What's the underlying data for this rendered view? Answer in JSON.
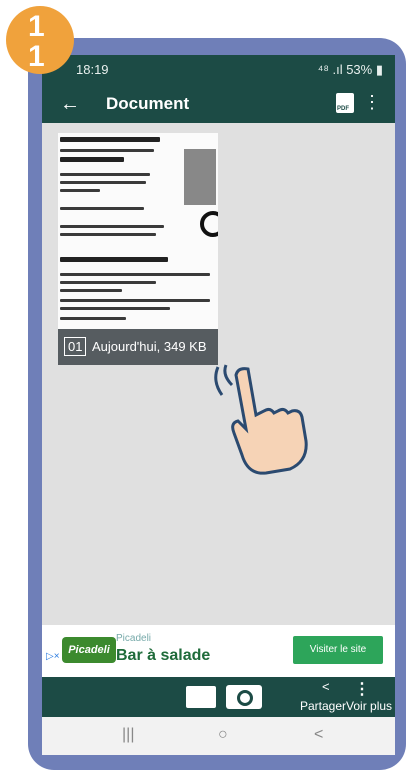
{
  "step": {
    "line1": "1",
    "line2": "1"
  },
  "status_bar": {
    "time": "18:19",
    "right": "⁴⁸ .ıl 53% ▮"
  },
  "app_bar": {
    "back": "←",
    "title": "Document",
    "pdf": "PDF",
    "more": "⋮"
  },
  "document": {
    "index": "01",
    "info": "Aujourd'hui, 349 KB"
  },
  "ad": {
    "logo": "Picadeli",
    "brand": "Picadeli",
    "headline": "Bar à salade",
    "cta": "Visiter le site"
  },
  "bottom_bar": {
    "share": "<",
    "more": "⋮",
    "labels": "PartagerVoir plus"
  },
  "nav": {
    "recent": "|||",
    "home": "○",
    "back": "<"
  },
  "colors": {
    "header": "#1c4b45",
    "accent": "#f0a23c",
    "frame": "#6f7fb8",
    "ad_button": "#2da55a"
  }
}
